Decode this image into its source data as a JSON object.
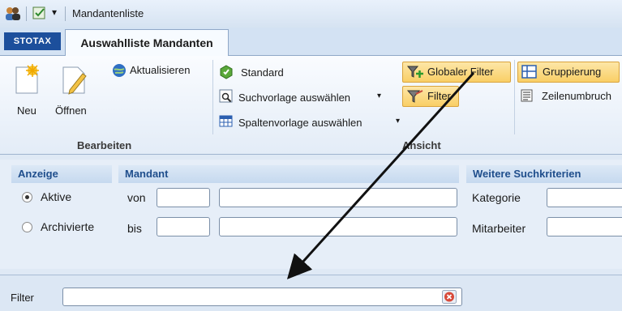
{
  "window": {
    "title": "Mandantenliste"
  },
  "brand": {
    "logo": "STOTAX"
  },
  "tabs": [
    {
      "label": "Auswahlliste Mandanten",
      "active": true
    }
  ],
  "ribbon": {
    "bearbeiten": {
      "label": "Bearbeiten",
      "neu": "Neu",
      "oeffnen": "Öffnen",
      "aktualisieren": "Aktualisieren"
    },
    "ansicht": {
      "label": "Ansicht",
      "standard": "Standard",
      "suchvorlage": "Suchvorlage auswählen",
      "spaltenvorlage": "Spaltenvorlage auswählen",
      "globaler_filter": "Globaler Filter",
      "filter": "Filter",
      "gruppierung": "Gruppierung",
      "zeilenumbruch": "Zeilenumbruch"
    }
  },
  "criteria": {
    "anzeige": {
      "header": "Anzeige",
      "options": [
        "Aktive",
        "Archivierte"
      ],
      "selected": "Aktive"
    },
    "mandant": {
      "header": "Mandant",
      "von_label": "von",
      "bis_label": "bis",
      "von_value": "",
      "bis_value": ""
    },
    "weitere": {
      "header": "Weitere Suchkriterien",
      "kategorie_label": "Kategorie",
      "mitarbeiter_label": "Mitarbeiter"
    }
  },
  "filter": {
    "label": "Filter",
    "value": ""
  },
  "colors": {
    "accent": "#1f4e8c",
    "highlight": "#f9cf66",
    "brand": "#1c4f9c"
  }
}
